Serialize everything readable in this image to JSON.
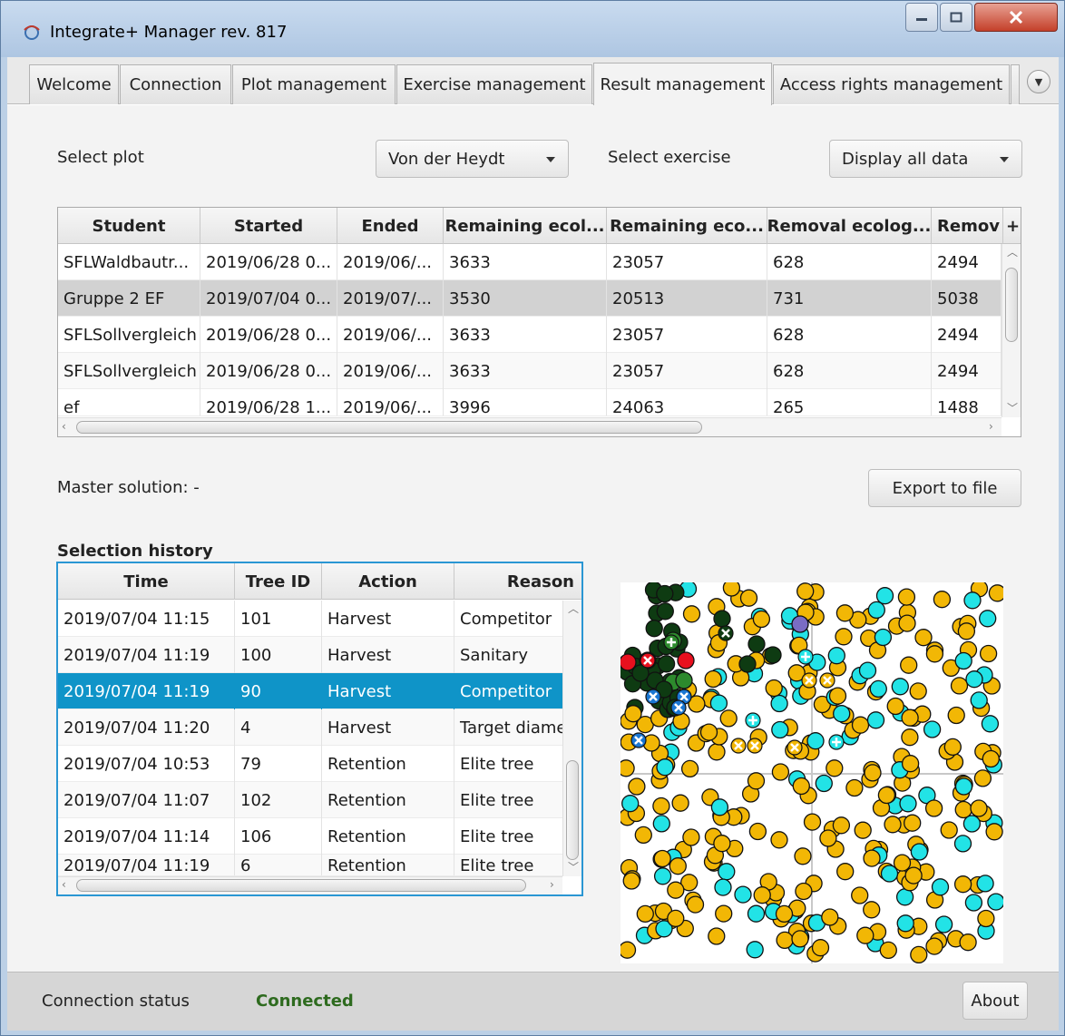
{
  "window": {
    "title": "Integrate+ Manager rev. 817",
    "buttons": {
      "minimize": "minimize-icon",
      "maximize": "maximize-icon",
      "close": "close-icon"
    }
  },
  "tabs": [
    {
      "label": "Welcome",
      "active": false
    },
    {
      "label": "Connection",
      "active": false
    },
    {
      "label": "Plot management",
      "active": false
    },
    {
      "label": "Exercise management",
      "active": false
    },
    {
      "label": "Result management",
      "active": true
    },
    {
      "label": "Access rights management",
      "active": false
    }
  ],
  "filters": {
    "plot_label": "Select plot",
    "plot_value": "Von der Heydt",
    "exercise_label": "Select exercise",
    "exercise_value": "Display all data"
  },
  "results_table": {
    "columns": [
      "Student",
      "Started",
      "Ended",
      "Remaining ecol...",
      "Remaining eco...",
      "Removal ecolog...",
      "Remov"
    ],
    "add_column": "+",
    "rows": [
      [
        "SFLWaldbautr...",
        "2019/06/28 0...",
        "2019/06/...",
        "3633",
        "23057",
        "628",
        "2494"
      ],
      [
        "Gruppe 2 EF",
        "2019/07/04 0...",
        "2019/07/...",
        "3530",
        "20513",
        "731",
        "5038"
      ],
      [
        "SFLSollvergleich",
        "2019/06/28 0...",
        "2019/06/...",
        "3633",
        "23057",
        "628",
        "2494"
      ],
      [
        "SFLSollvergleich",
        "2019/06/28 0...",
        "2019/06/...",
        "3633",
        "23057",
        "628",
        "2494"
      ],
      [
        "ef",
        "2019/06/28 1...",
        "2019/06/...",
        "3996",
        "24063",
        "265",
        "1488"
      ]
    ],
    "selected_row": 1
  },
  "master_solution": "Master solution: -",
  "export_button": "Export to file",
  "history": {
    "title": "Selection history",
    "columns": [
      "Time",
      "Tree ID",
      "Action",
      "Reason"
    ],
    "rows": [
      [
        "2019/07/04 11:15",
        "101",
        "Harvest",
        "Competitor"
      ],
      [
        "2019/07/04 11:19",
        "100",
        "Harvest",
        "Sanitary"
      ],
      [
        "2019/07/04 11:19",
        "90",
        "Harvest",
        "Competitor"
      ],
      [
        "2019/07/04 11:20",
        "4",
        "Harvest",
        "Target diame"
      ],
      [
        "2019/07/04 10:53",
        "79",
        "Retention",
        "Elite tree"
      ],
      [
        "2019/07/04 11:07",
        "102",
        "Retention",
        "Elite tree"
      ],
      [
        "2019/07/04 11:14",
        "106",
        "Retention",
        "Elite tree"
      ],
      [
        "2019/07/04 11:19",
        "6",
        "Retention",
        "Elite tree"
      ]
    ],
    "selected_row": 2
  },
  "map": {
    "colors": {
      "yellow": "#f2b705",
      "cyan": "#22e3e6",
      "darkgreen": "#0e3b12",
      "green": "#2d8a2d",
      "red": "#e8101e",
      "blue": "#1976d2",
      "purple": "#7a6cc4"
    }
  },
  "status": {
    "label": "Connection status",
    "value": "Connected",
    "value_color": "#2e6b1f",
    "about_button": "About"
  }
}
